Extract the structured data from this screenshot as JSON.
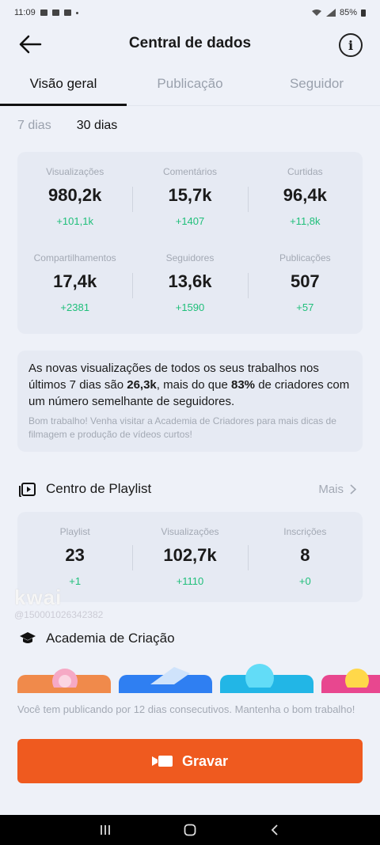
{
  "status": {
    "time": "11:09",
    "battery": "85%"
  },
  "header": {
    "title": "Central de dados"
  },
  "tabs": [
    {
      "label": "Visão geral",
      "active": true
    },
    {
      "label": "Publicação",
      "active": false
    },
    {
      "label": "Seguidor",
      "active": false
    }
  ],
  "period": {
    "options": [
      "7 dias",
      "30 dias"
    ],
    "selected": "30 dias"
  },
  "stats": [
    {
      "label": "Visualizações",
      "value": "980,2k",
      "delta": "+101,1k"
    },
    {
      "label": "Comentários",
      "value": "15,7k",
      "delta": "+1407"
    },
    {
      "label": "Curtidas",
      "value": "96,4k",
      "delta": "+11,8k"
    },
    {
      "label": "Compartilhamentos",
      "value": "17,4k",
      "delta": "+2381"
    },
    {
      "label": "Seguidores",
      "value": "13,6k",
      "delta": "+1590"
    },
    {
      "label": "Publicações",
      "value": "507",
      "delta": "+57"
    }
  ],
  "insight": {
    "part1": "As novas visualizações de todos os seus trabalhos nos últimos 7 dias são ",
    "value": "26,3k",
    "part2": ", mais do que ",
    "percent": "83%",
    "part3": " de criadores com um número semelhante de seguidores.",
    "sub": "Bom trabalho! Venha visitar a Academia de Criadores para mais dicas de filmagem e produção de vídeos curtos!"
  },
  "playlist": {
    "title": "Centro de Playlist",
    "more": "Mais",
    "stats": [
      {
        "label": "Playlist",
        "value": "23",
        "delta": "+1"
      },
      {
        "label": "Visualizações",
        "value": "102,7k",
        "delta": "+1110"
      },
      {
        "label": "Inscrições",
        "value": "8",
        "delta": "+0"
      }
    ]
  },
  "watermark": {
    "brand": "kwai",
    "id": "@150001026342382"
  },
  "academy": {
    "title": "Academia de Criação"
  },
  "bottom": {
    "message": "Você tem publicando por 12 dias consecutivos. Mantenha o bom trabalho!",
    "record_label": "Gravar"
  },
  "colors": {
    "accent": "#ef5a1f",
    "positive": "#1fbf7a",
    "muted": "#a3a9b4"
  }
}
